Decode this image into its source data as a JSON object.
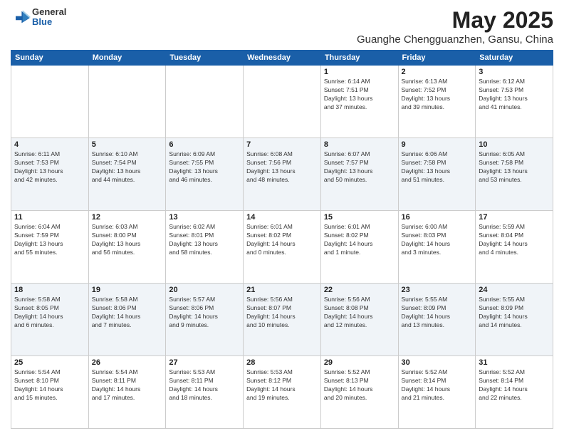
{
  "header": {
    "logo": {
      "general": "General",
      "blue": "Blue"
    },
    "title": "May 2025",
    "location": "Guanghe Chengguanzhen, Gansu, China"
  },
  "weekdays": [
    "Sunday",
    "Monday",
    "Tuesday",
    "Wednesday",
    "Thursday",
    "Friday",
    "Saturday"
  ],
  "weeks": [
    [
      {
        "day": "",
        "info": ""
      },
      {
        "day": "",
        "info": ""
      },
      {
        "day": "",
        "info": ""
      },
      {
        "day": "",
        "info": ""
      },
      {
        "day": "1",
        "info": "Sunrise: 6:14 AM\nSunset: 7:51 PM\nDaylight: 13 hours\nand 37 minutes."
      },
      {
        "day": "2",
        "info": "Sunrise: 6:13 AM\nSunset: 7:52 PM\nDaylight: 13 hours\nand 39 minutes."
      },
      {
        "day": "3",
        "info": "Sunrise: 6:12 AM\nSunset: 7:53 PM\nDaylight: 13 hours\nand 41 minutes."
      }
    ],
    [
      {
        "day": "4",
        "info": "Sunrise: 6:11 AM\nSunset: 7:53 PM\nDaylight: 13 hours\nand 42 minutes."
      },
      {
        "day": "5",
        "info": "Sunrise: 6:10 AM\nSunset: 7:54 PM\nDaylight: 13 hours\nand 44 minutes."
      },
      {
        "day": "6",
        "info": "Sunrise: 6:09 AM\nSunset: 7:55 PM\nDaylight: 13 hours\nand 46 minutes."
      },
      {
        "day": "7",
        "info": "Sunrise: 6:08 AM\nSunset: 7:56 PM\nDaylight: 13 hours\nand 48 minutes."
      },
      {
        "day": "8",
        "info": "Sunrise: 6:07 AM\nSunset: 7:57 PM\nDaylight: 13 hours\nand 50 minutes."
      },
      {
        "day": "9",
        "info": "Sunrise: 6:06 AM\nSunset: 7:58 PM\nDaylight: 13 hours\nand 51 minutes."
      },
      {
        "day": "10",
        "info": "Sunrise: 6:05 AM\nSunset: 7:58 PM\nDaylight: 13 hours\nand 53 minutes."
      }
    ],
    [
      {
        "day": "11",
        "info": "Sunrise: 6:04 AM\nSunset: 7:59 PM\nDaylight: 13 hours\nand 55 minutes."
      },
      {
        "day": "12",
        "info": "Sunrise: 6:03 AM\nSunset: 8:00 PM\nDaylight: 13 hours\nand 56 minutes."
      },
      {
        "day": "13",
        "info": "Sunrise: 6:02 AM\nSunset: 8:01 PM\nDaylight: 13 hours\nand 58 minutes."
      },
      {
        "day": "14",
        "info": "Sunrise: 6:01 AM\nSunset: 8:02 PM\nDaylight: 14 hours\nand 0 minutes."
      },
      {
        "day": "15",
        "info": "Sunrise: 6:01 AM\nSunset: 8:02 PM\nDaylight: 14 hours\nand 1 minute."
      },
      {
        "day": "16",
        "info": "Sunrise: 6:00 AM\nSunset: 8:03 PM\nDaylight: 14 hours\nand 3 minutes."
      },
      {
        "day": "17",
        "info": "Sunrise: 5:59 AM\nSunset: 8:04 PM\nDaylight: 14 hours\nand 4 minutes."
      }
    ],
    [
      {
        "day": "18",
        "info": "Sunrise: 5:58 AM\nSunset: 8:05 PM\nDaylight: 14 hours\nand 6 minutes."
      },
      {
        "day": "19",
        "info": "Sunrise: 5:58 AM\nSunset: 8:06 PM\nDaylight: 14 hours\nand 7 minutes."
      },
      {
        "day": "20",
        "info": "Sunrise: 5:57 AM\nSunset: 8:06 PM\nDaylight: 14 hours\nand 9 minutes."
      },
      {
        "day": "21",
        "info": "Sunrise: 5:56 AM\nSunset: 8:07 PM\nDaylight: 14 hours\nand 10 minutes."
      },
      {
        "day": "22",
        "info": "Sunrise: 5:56 AM\nSunset: 8:08 PM\nDaylight: 14 hours\nand 12 minutes."
      },
      {
        "day": "23",
        "info": "Sunrise: 5:55 AM\nSunset: 8:09 PM\nDaylight: 14 hours\nand 13 minutes."
      },
      {
        "day": "24",
        "info": "Sunrise: 5:55 AM\nSunset: 8:09 PM\nDaylight: 14 hours\nand 14 minutes."
      }
    ],
    [
      {
        "day": "25",
        "info": "Sunrise: 5:54 AM\nSunset: 8:10 PM\nDaylight: 14 hours\nand 15 minutes."
      },
      {
        "day": "26",
        "info": "Sunrise: 5:54 AM\nSunset: 8:11 PM\nDaylight: 14 hours\nand 17 minutes."
      },
      {
        "day": "27",
        "info": "Sunrise: 5:53 AM\nSunset: 8:11 PM\nDaylight: 14 hours\nand 18 minutes."
      },
      {
        "day": "28",
        "info": "Sunrise: 5:53 AM\nSunset: 8:12 PM\nDaylight: 14 hours\nand 19 minutes."
      },
      {
        "day": "29",
        "info": "Sunrise: 5:52 AM\nSunset: 8:13 PM\nDaylight: 14 hours\nand 20 minutes."
      },
      {
        "day": "30",
        "info": "Sunrise: 5:52 AM\nSunset: 8:14 PM\nDaylight: 14 hours\nand 21 minutes."
      },
      {
        "day": "31",
        "info": "Sunrise: 5:52 AM\nSunset: 8:14 PM\nDaylight: 14 hours\nand 22 minutes."
      }
    ]
  ]
}
